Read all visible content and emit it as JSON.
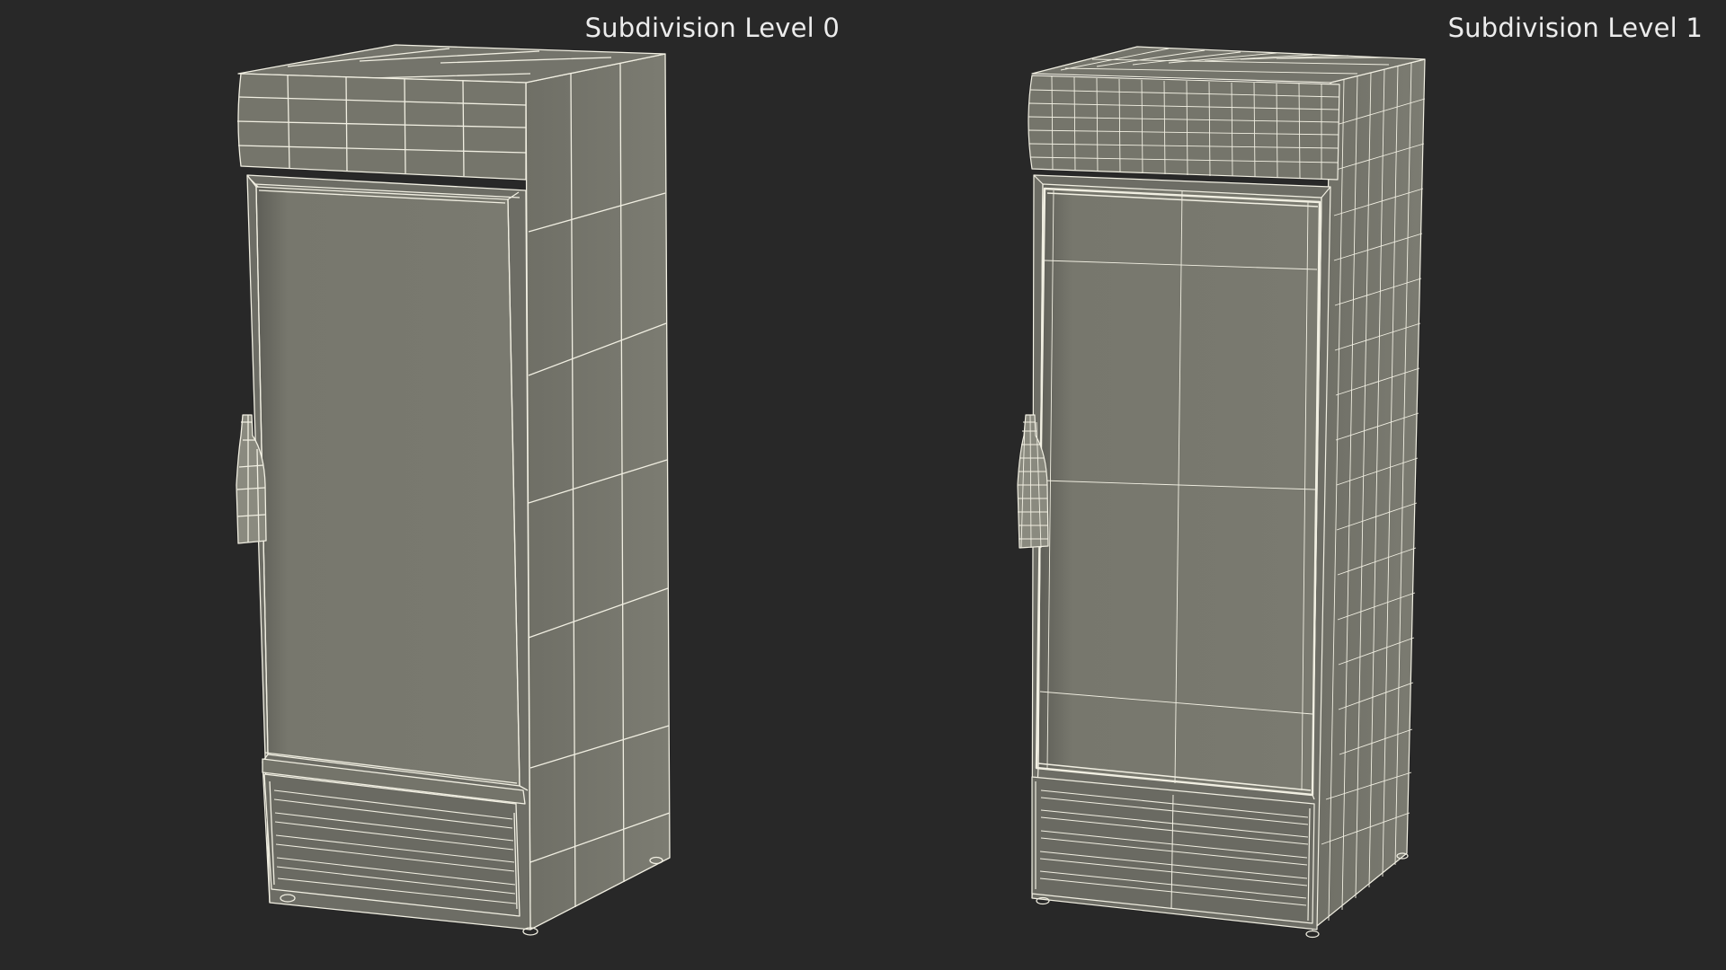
{
  "views": [
    {
      "label": "Subdivision Level 0"
    },
    {
      "label": "Subdivision Level 1"
    }
  ],
  "colors": {
    "background": "#282828",
    "panel": "#7a7a70",
    "wire": "#f1efe2",
    "label": "#ececec"
  }
}
